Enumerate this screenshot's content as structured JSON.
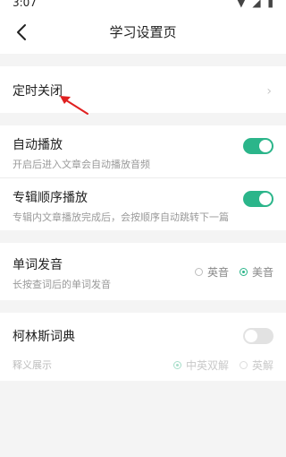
{
  "status_bar": {
    "time": "3:07",
    "icons": "▼ ◢ ▮"
  },
  "header": {
    "title": "学习设置页",
    "back_icon": "chevron-left-icon"
  },
  "timer": {
    "title": "定时关闭",
    "chevron": "›"
  },
  "autoplay": {
    "title": "自动播放",
    "subtitle": "开启后进入文章会自动播放音频",
    "enabled": true
  },
  "album_order": {
    "title": "专辑顺序播放",
    "subtitle": "专辑内文章播放完成后，会按顺序自动跳转下一篇",
    "enabled": true
  },
  "word_pron": {
    "title": "单词发音",
    "subtitle": "长按查词后的单词发音",
    "options": [
      {
        "label": "英音",
        "selected": false
      },
      {
        "label": "美音",
        "selected": true
      }
    ]
  },
  "collins": {
    "title": "柯林斯词典",
    "enabled": false,
    "sub_label": "释义展示",
    "options": [
      {
        "label": "中英双解",
        "selected": true
      },
      {
        "label": "英解",
        "selected": false
      }
    ]
  },
  "colors": {
    "accent": "#2bb58a",
    "arrow": "#e02020",
    "background": "#f4f4f4"
  }
}
